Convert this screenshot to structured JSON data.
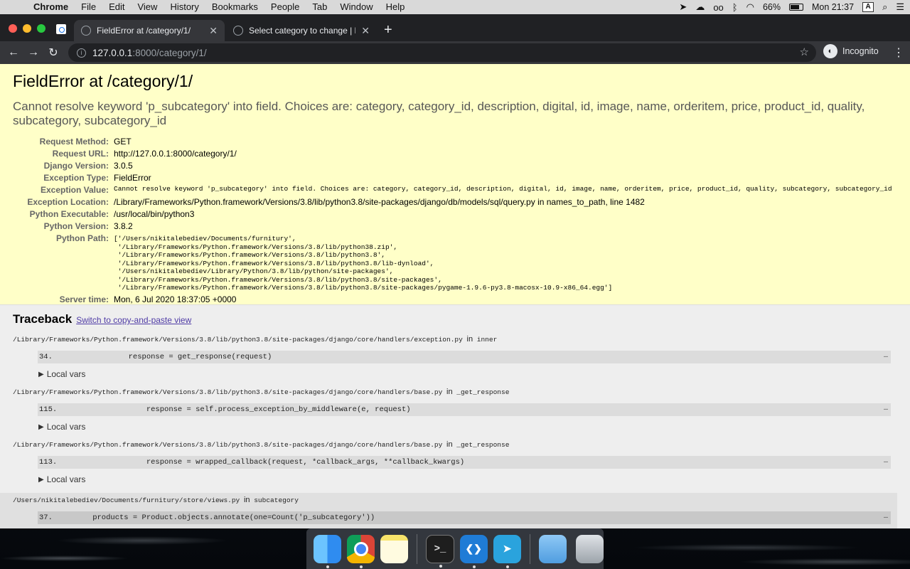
{
  "menubar": {
    "app_name": "Chrome",
    "items": [
      "File",
      "Edit",
      "View",
      "History",
      "Bookmarks",
      "People",
      "Tab",
      "Window",
      "Help"
    ],
    "battery": "66%",
    "clock": "Mon 21:37",
    "input_source": "A"
  },
  "browser": {
    "tabs": [
      {
        "title": "FieldError at /category/1/",
        "active": true
      },
      {
        "title": "Select category to change | Dja",
        "active": false
      }
    ],
    "address": {
      "host": "127.0.0.1",
      "path": ":8000/category/1/"
    },
    "profile_label": "Incognito"
  },
  "error": {
    "title": "FieldError at /category/1/",
    "message": "Cannot resolve keyword 'p_subcategory' into field. Choices are: category, category_id, description, digital, id, image, name, orderitem, price, product_id, quality, subcategory, subcategory_id",
    "meta": [
      {
        "label": "Request Method:",
        "value": "GET"
      },
      {
        "label": "Request URL:",
        "value": "http://127.0.0.1:8000/category/1/"
      },
      {
        "label": "Django Version:",
        "value": "3.0.5"
      },
      {
        "label": "Exception Type:",
        "value": "FieldError"
      },
      {
        "label": "Exception Value:",
        "value": "Cannot resolve keyword 'p_subcategory' into field. Choices are: category, category_id, description, digital, id, image, name, orderitem, price, product_id, quality, subcategory, subcategory_id"
      },
      {
        "label": "Exception Location:",
        "value": "/Library/Frameworks/Python.framework/Versions/3.8/lib/python3.8/site-packages/django/db/models/sql/query.py in names_to_path, line 1482"
      },
      {
        "label": "Python Executable:",
        "value": "/usr/local/bin/python3"
      },
      {
        "label": "Python Version:",
        "value": "3.8.2"
      },
      {
        "label": "Python Path:",
        "value": "['/Users/nikitalebediev/Documents/furnitury',\n '/Library/Frameworks/Python.framework/Versions/3.8/lib/python38.zip',\n '/Library/Frameworks/Python.framework/Versions/3.8/lib/python3.8',\n '/Library/Frameworks/Python.framework/Versions/3.8/lib/python3.8/lib-dynload',\n '/Users/nikitalebediev/Library/Python/3.8/lib/python/site-packages',\n '/Library/Frameworks/Python.framework/Versions/3.8/lib/python3.8/site-packages',\n '/Library/Frameworks/Python.framework/Versions/3.8/lib/python3.8/site-packages/pygame-1.9.6-py3.8-macosx-10.9-x86_64.egg']"
      },
      {
        "label": "Server time:",
        "value": "Mon, 6 Jul 2020 18:37:05 +0000"
      }
    ]
  },
  "traceback": {
    "heading": "Traceback",
    "switch_link": "Switch to copy-and-paste view",
    "in_word": "in",
    "local_vars_label": "Local vars",
    "ellipsis": "…",
    "frames": [
      {
        "file": "/Library/Frameworks/Python.framework/Versions/3.8/lib/python3.8/site-packages/django/core/handlers/exception.py",
        "func": "inner",
        "line": "34.",
        "code": "            response = get_response(request)"
      },
      {
        "file": "/Library/Frameworks/Python.framework/Versions/3.8/lib/python3.8/site-packages/django/core/handlers/base.py",
        "func": "_get_response",
        "line": "115.",
        "code": "                response = self.process_exception_by_middleware(e, request)"
      },
      {
        "file": "/Library/Frameworks/Python.framework/Versions/3.8/lib/python3.8/site-packages/django/core/handlers/base.py",
        "func": "_get_response",
        "line": "113.",
        "code": "                response = wrapped_callback(request, *callback_args, **callback_kwargs)"
      },
      {
        "file": "/Users/nikitalebediev/Documents/furnitury/store/views.py",
        "func": "subcategory",
        "line": "37.",
        "code": "    products = Product.objects.annotate(one=Count('p_subcategory'))"
      }
    ]
  },
  "dock": {
    "apps": [
      "finder",
      "chrome",
      "notes",
      "terminal",
      "vscode",
      "telegram",
      "folder",
      "trash"
    ],
    "terminal_prompt": ">_"
  }
}
